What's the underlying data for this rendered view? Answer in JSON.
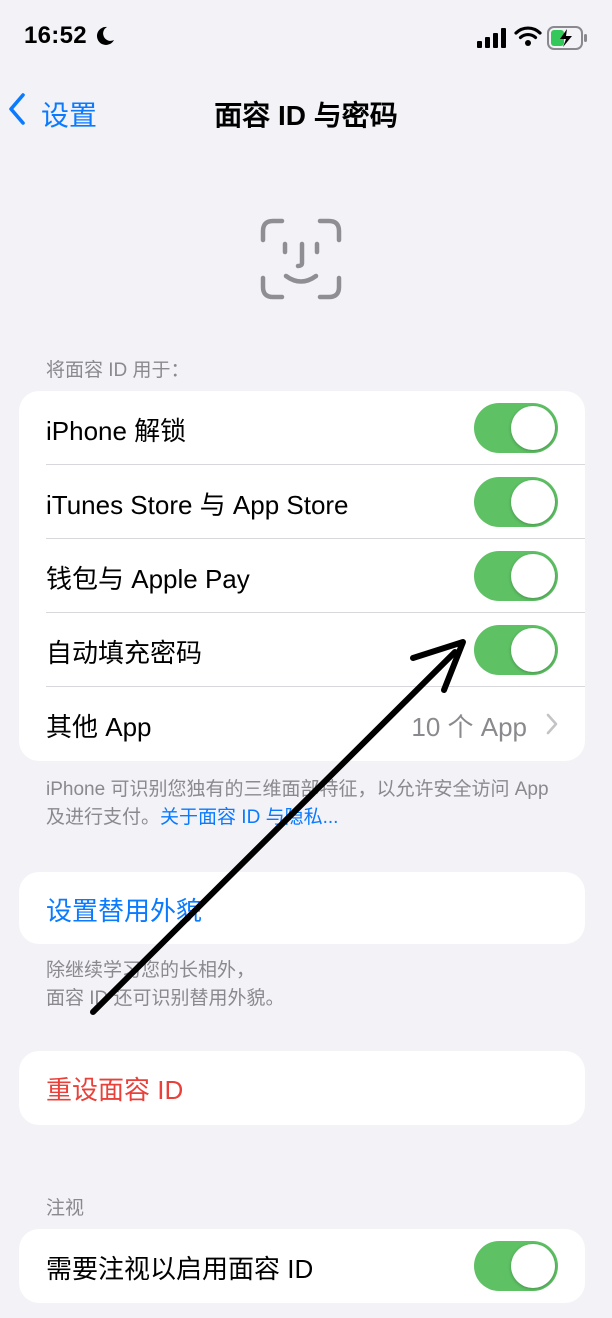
{
  "status_bar": {
    "time": "16:52"
  },
  "nav": {
    "back_label": "设置",
    "title": "面容 ID 与密码"
  },
  "use_section": {
    "header": "将面容 ID 用于：",
    "rows": [
      {
        "label": "iPhone 解锁",
        "toggle_on": true
      },
      {
        "label": "iTunes Store 与 App Store",
        "toggle_on": true
      },
      {
        "label": "钱包与 Apple Pay",
        "toggle_on": true
      },
      {
        "label": "自动填充密码",
        "toggle_on": true
      },
      {
        "label": "其他 App",
        "value": "10 个 App"
      }
    ],
    "footer_text": "iPhone 可识别您独有的三维面部特征，以允许安全访问 App 及进行支付。",
    "footer_link": "关于面容 ID 与隐私..."
  },
  "alternate": {
    "action": "设置替用外貌",
    "footer_line1": "除继续学习您的长相外，",
    "footer_line2": "面容 ID 还可识别替用外貌。"
  },
  "reset": {
    "action": "重设面容 ID"
  },
  "attention": {
    "header": "注视",
    "row_label": "需要注视以启用面容 ID",
    "toggle_on": true
  },
  "colors": {
    "accent_blue": "#0a7aff",
    "toggle_green": "#5ec164",
    "destructive_red": "#e9413a",
    "background": "#f2f2f7"
  }
}
